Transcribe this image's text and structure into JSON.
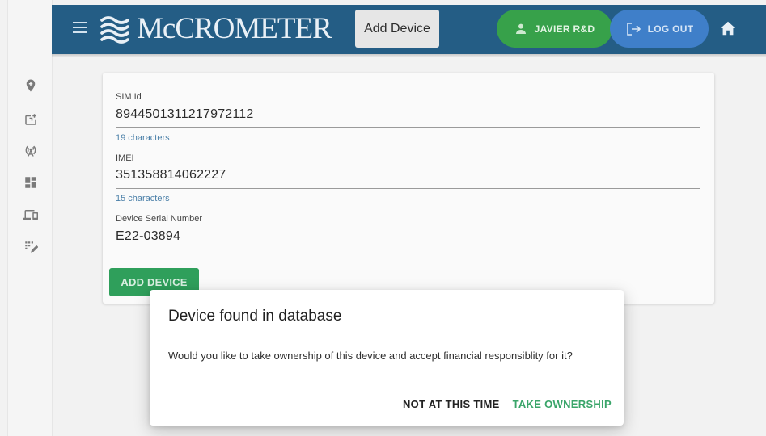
{
  "header": {
    "brand": "McCROMETER",
    "add_device_tab": "Add Device",
    "user_name": "JAVIER R&D",
    "logout_label": "LOG OUT"
  },
  "sidebar": {
    "items": [
      {
        "icon": "map-marker-icon"
      },
      {
        "icon": "device-add-icon"
      },
      {
        "icon": "antenna-icon"
      },
      {
        "icon": "dashboard-icon"
      },
      {
        "icon": "devices-icon"
      },
      {
        "icon": "grid-edit-icon"
      }
    ]
  },
  "form": {
    "sim_id": {
      "label": "SIM Id",
      "value": "8944501311217972112",
      "hint": "19 characters"
    },
    "imei": {
      "label": "IMEI",
      "value": "351358814062227",
      "hint": "15 characters"
    },
    "serial": {
      "label": "Device Serial Number",
      "value": "E22-03894"
    },
    "submit_label": "ADD DEVICE"
  },
  "dialog": {
    "title": "Device found in database",
    "body": "Would you like to take ownership of this device and accept financial responsiblity for it?",
    "decline_label": "NOT AT THIS TIME",
    "accept_label": "TAKE OWNERSHIP"
  },
  "colors": {
    "header_bg": "#245d85",
    "user_pill": "#37a14a",
    "logout_pill": "#3f7fc9",
    "primary_green": "#2f9f5b",
    "accept_text": "#3aa56a"
  }
}
